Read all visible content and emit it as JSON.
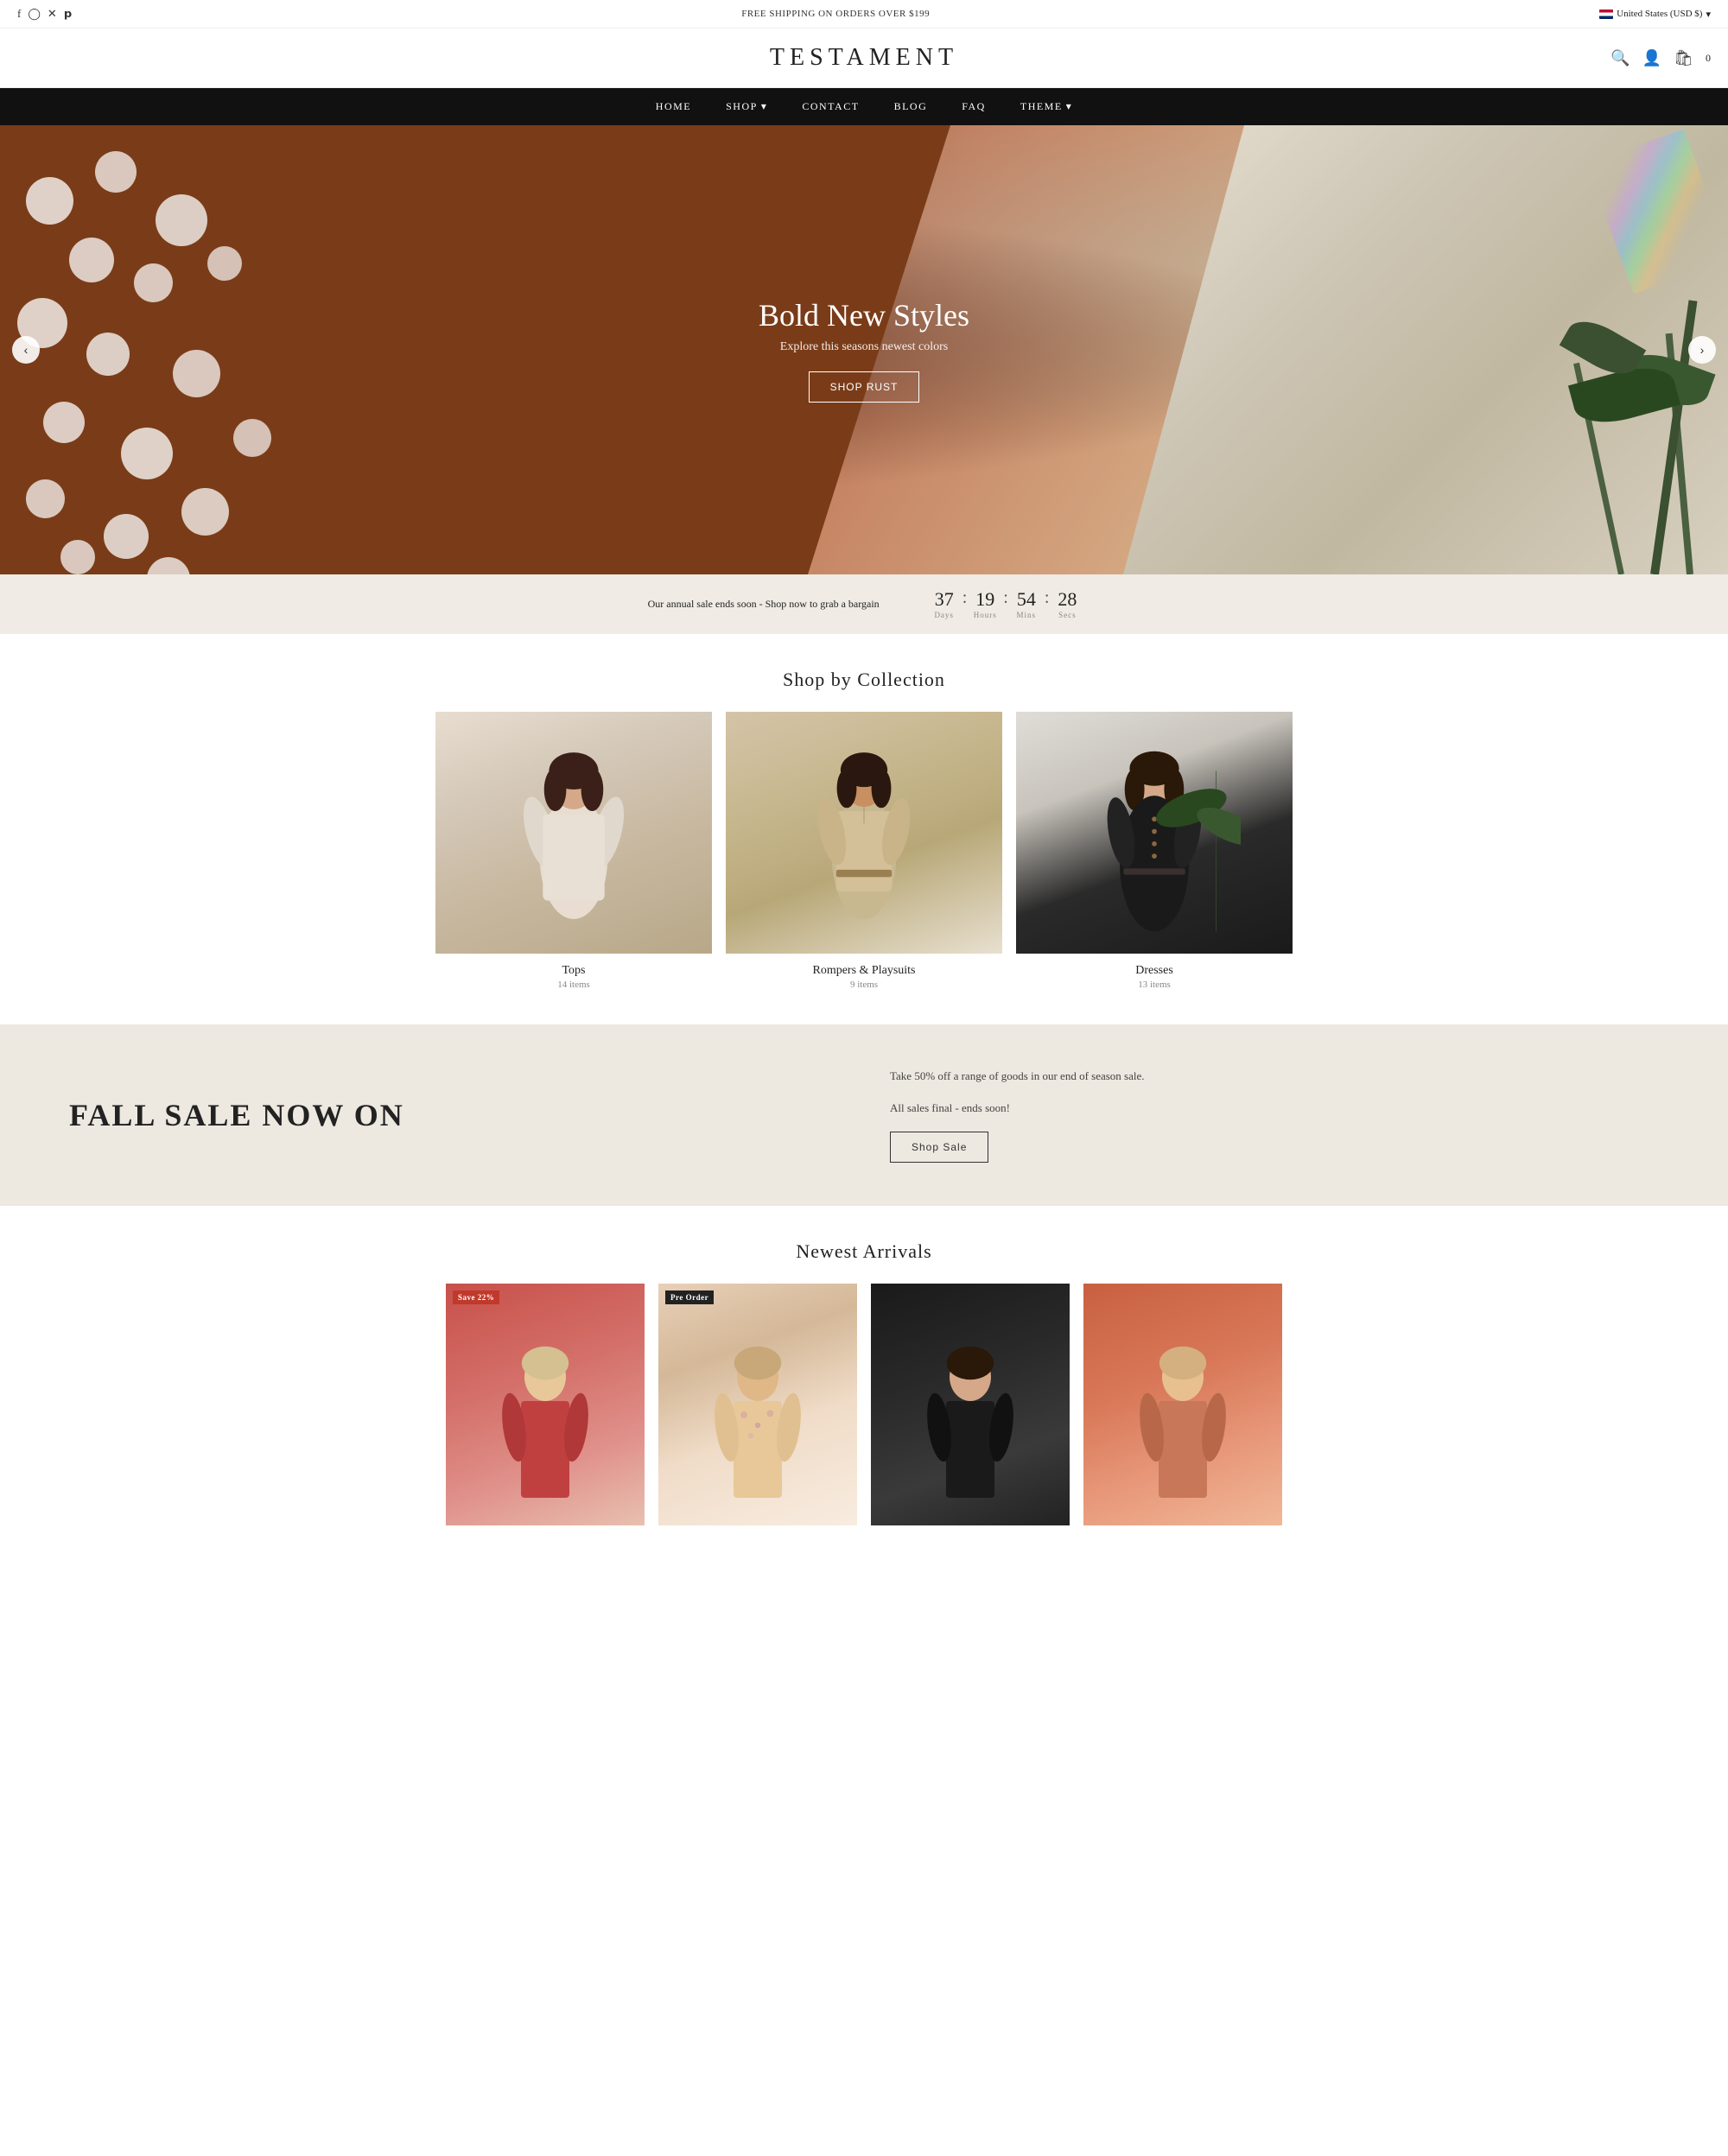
{
  "topbar": {
    "shipping_text": "FREE SHIPPING ON ORDERS OVER $199",
    "locale": "United States (USD $)"
  },
  "header": {
    "logo": "TESTAMENT",
    "cart_count": "0"
  },
  "nav": {
    "items": [
      {
        "label": "HOME",
        "has_dropdown": false
      },
      {
        "label": "SHOP",
        "has_dropdown": true
      },
      {
        "label": "CONTACT",
        "has_dropdown": false
      },
      {
        "label": "BLOG",
        "has_dropdown": false
      },
      {
        "label": "FAQ",
        "has_dropdown": false
      },
      {
        "label": "THEME",
        "has_dropdown": true
      }
    ]
  },
  "hero": {
    "title": "Bold New Styles",
    "subtitle": "Explore this seasons newest colors",
    "cta_label": "Shop Rust",
    "prev_label": "‹",
    "next_label": "›"
  },
  "countdown": {
    "text": "Our annual sale ends soon -",
    "link_text": "Shop now",
    "link_suffix": " to grab a bargain",
    "days": "37",
    "hours": "19",
    "mins": "54",
    "secs": "28",
    "labels": [
      "Days",
      "Hours",
      "Mins",
      "Secs"
    ]
  },
  "collections": {
    "section_title": "Shop by Collection",
    "items": [
      {
        "name": "Tops",
        "count": "14 items"
      },
      {
        "name": "Rompers & Playsuits",
        "count": "9 items"
      },
      {
        "name": "Dresses",
        "count": "13 items"
      }
    ]
  },
  "fall_sale": {
    "title": "FALL SALE NOW ON",
    "description_line1": "Take 50% off a range of goods in our end of season sale.",
    "description_line2": "All sales final - ends soon!",
    "cta_label": "Shop Sale"
  },
  "newest_arrivals": {
    "section_title": "Newest Arrivals",
    "items": [
      {
        "badge": "Save 22%",
        "badge_type": "sale"
      },
      {
        "badge": "Pre Order",
        "badge_type": "preorder"
      },
      {
        "badge": "",
        "badge_type": ""
      },
      {
        "badge": "",
        "badge_type": ""
      }
    ]
  }
}
